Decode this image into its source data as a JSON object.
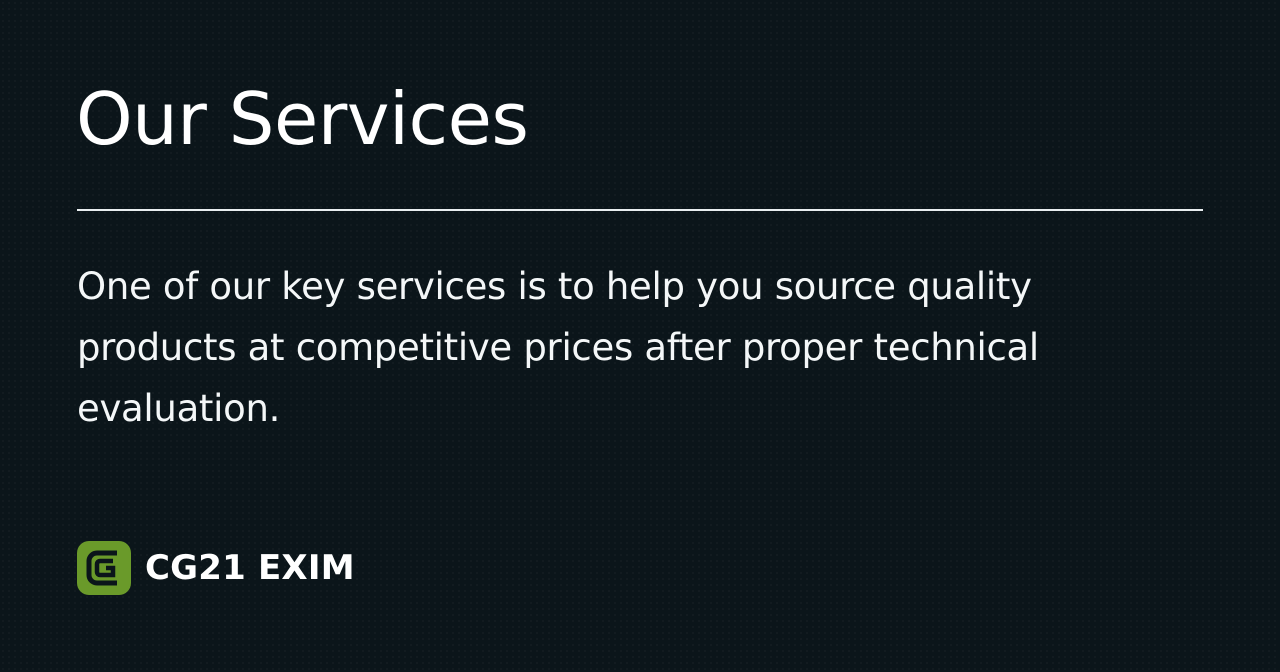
{
  "page": {
    "title": "Our Services",
    "description": "One of our key services is to help you source quality products at competitive prices after proper technical evaluation."
  },
  "brand": {
    "name": "CG21 EXIM",
    "logo_icon": "cg-logo-icon",
    "logo_color": "#6a9a2a"
  },
  "colors": {
    "background": "#0b151a",
    "text": "#ffffff",
    "accent": "#6a9a2a"
  }
}
